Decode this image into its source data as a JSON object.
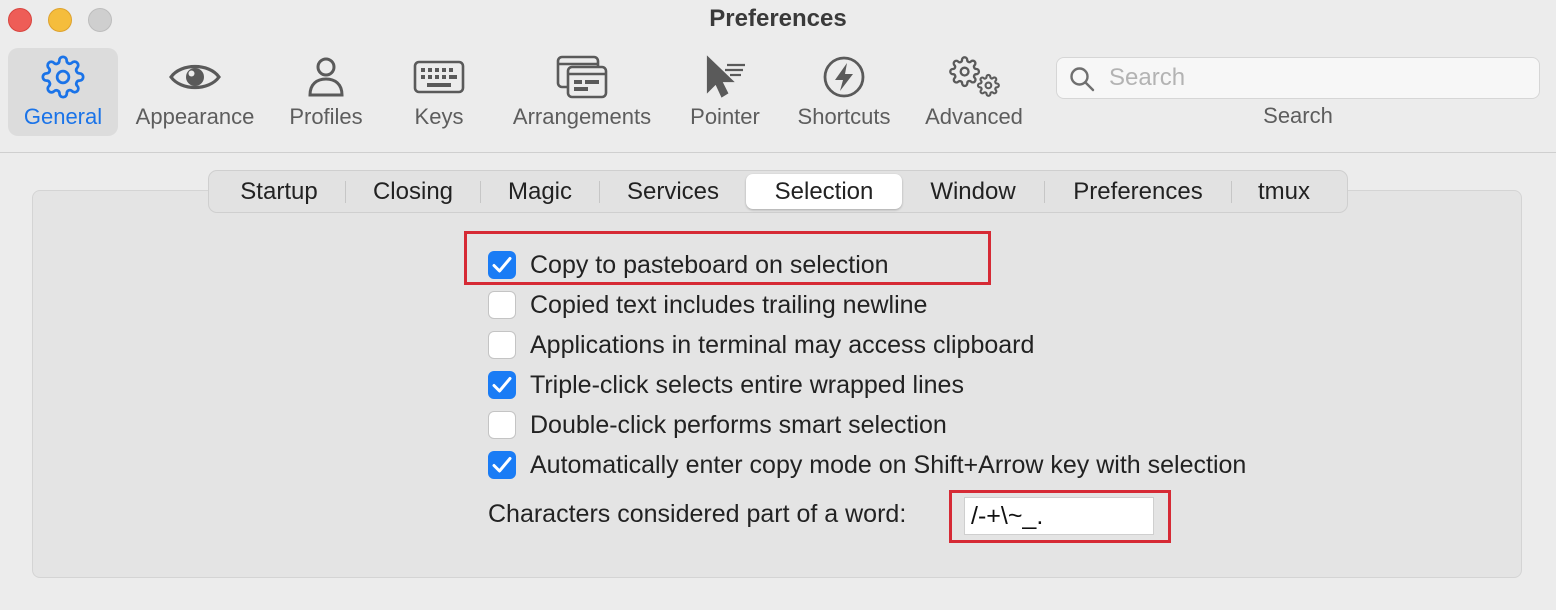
{
  "window": {
    "title": "Preferences"
  },
  "toolbar": {
    "items": [
      {
        "label": "General",
        "icon": "gear-icon",
        "active": true
      },
      {
        "label": "Appearance",
        "icon": "eye-icon"
      },
      {
        "label": "Profiles",
        "icon": "person-icon"
      },
      {
        "label": "Keys",
        "icon": "keyboard-icon"
      },
      {
        "label": "Arrangements",
        "icon": "windows-icon"
      },
      {
        "label": "Pointer",
        "icon": "cursor-icon"
      },
      {
        "label": "Shortcuts",
        "icon": "bolt-icon"
      },
      {
        "label": "Advanced",
        "icon": "gears-icon"
      }
    ],
    "search": {
      "placeholder": "Search",
      "value": "",
      "label": "Search"
    }
  },
  "tabs": [
    {
      "label": "Startup"
    },
    {
      "label": "Closing"
    },
    {
      "label": "Magic"
    },
    {
      "label": "Services"
    },
    {
      "label": "Selection",
      "active": true
    },
    {
      "label": "Window"
    },
    {
      "label": "Preferences"
    },
    {
      "label": "tmux"
    }
  ],
  "selection": {
    "options": [
      {
        "label": "Copy to pasteboard on selection",
        "checked": true
      },
      {
        "label": "Copied text includes trailing newline",
        "checked": false
      },
      {
        "label": "Applications in terminal may access clipboard",
        "checked": false
      },
      {
        "label": "Triple-click selects entire wrapped lines",
        "checked": true
      },
      {
        "label": "Double-click performs smart selection",
        "checked": false
      },
      {
        "label": "Automatically enter copy mode on Shift+Arrow key with selection",
        "checked": true
      }
    ],
    "word_chars_label": "Characters considered part of a word:",
    "word_chars_value": "/-+\\~_."
  },
  "colors": {
    "accent": "#1a7cf5",
    "highlight": "#d62a35",
    "active_label": "#1a73e8"
  }
}
